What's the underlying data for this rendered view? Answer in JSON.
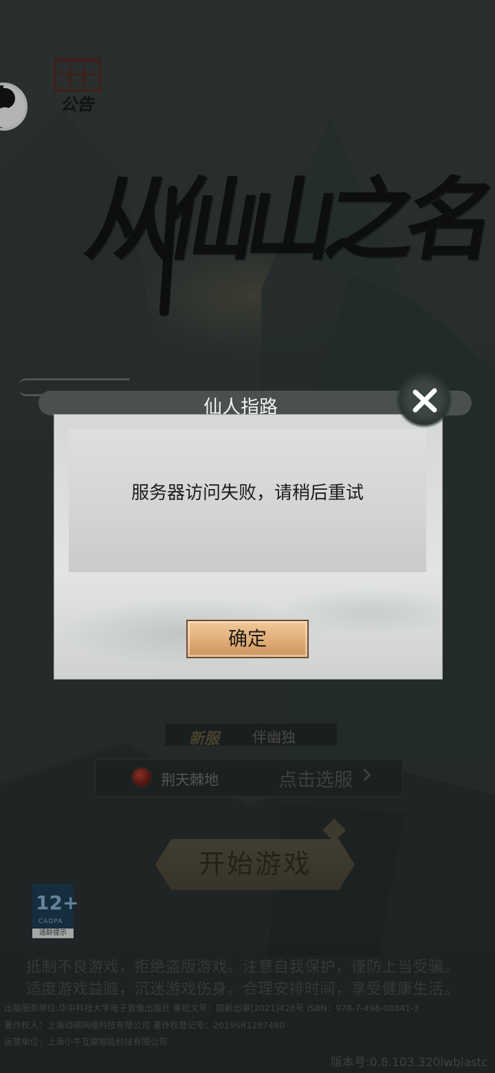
{
  "notice": {
    "label": "公告"
  },
  "game": {
    "title": "从仙山之名"
  },
  "dialog": {
    "title": "仙人指路",
    "message": "服务器访问失败，请稍后重试",
    "confirm_label": "确定"
  },
  "server": {
    "tag_new": "新服",
    "tag_name": "伴幽独",
    "current_name": "荆天棘地",
    "select_label": "点击选服"
  },
  "start_label": "开始游戏",
  "age_rating": {
    "number": "12+",
    "org": "CADPA",
    "tip": "适龄提示"
  },
  "footer": {
    "slogan_1": "抵制不良游戏，拒绝盗版游戏。注意自我保护，谨防上当受骗。",
    "slogan_2": "适度游戏益脑，沉迷游戏伤身。合理安排时间，享受健康生活。",
    "publisher": "出版服务单位:华中科技大学电子音像出版社 审批文号：国新出审[2021]428号 ISBN：978-7-498-08841-3",
    "copyright": "著作权人：上海动萌网络科技有限公司 著作权登记号：2019SR1287480",
    "operator": "运营单位：上海小牛互娱智能科技有限公司",
    "version": "版本号:0.8.103.320lwblastc"
  }
}
